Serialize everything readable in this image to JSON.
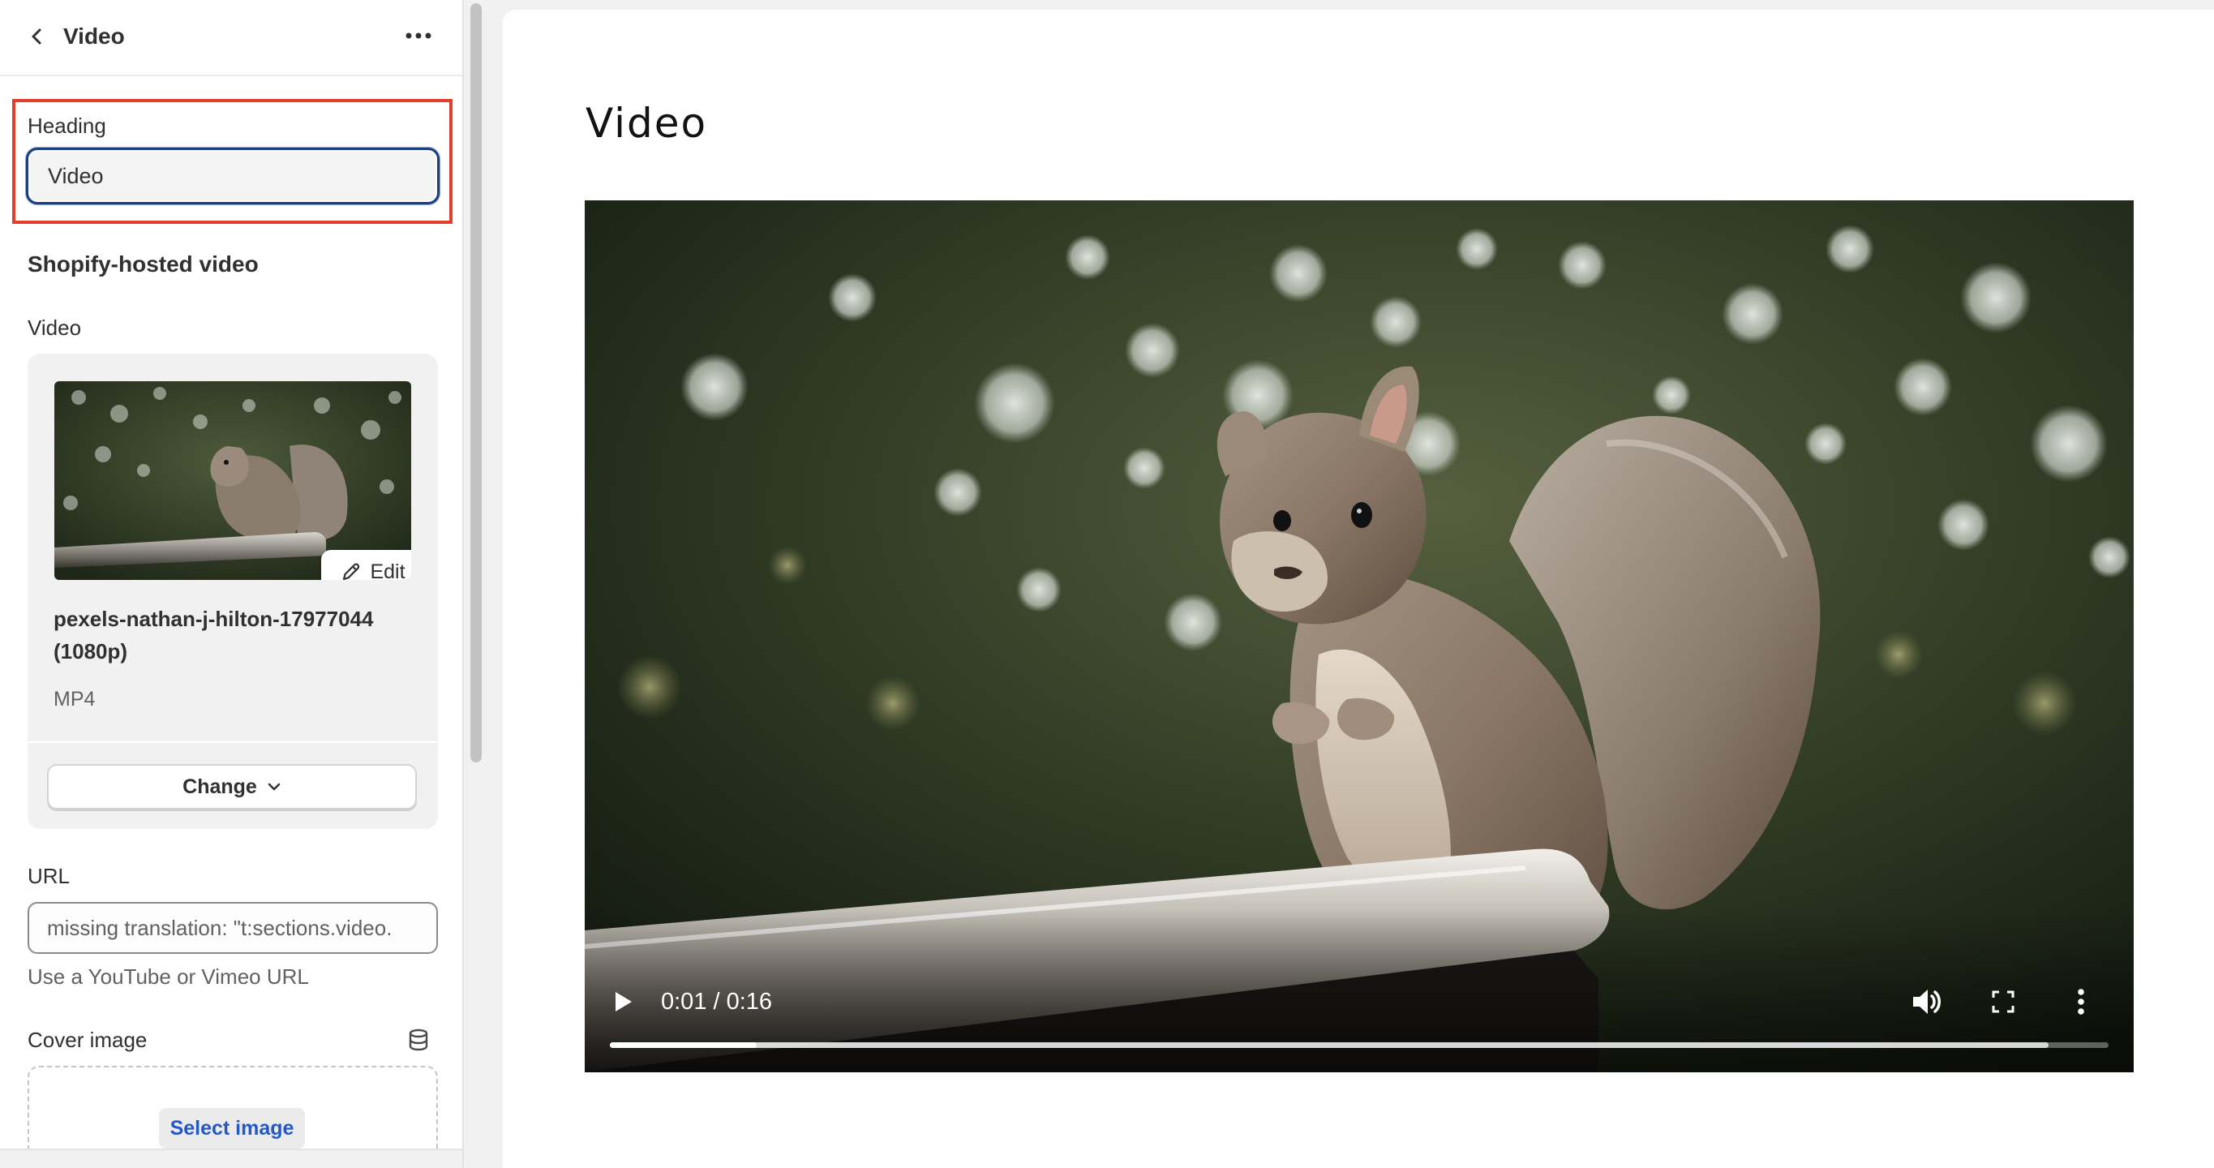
{
  "sidebar": {
    "title": "Video",
    "heading": {
      "label": "Heading",
      "value": "Video"
    },
    "hosted_video": {
      "title": "Shopify-hosted video",
      "label": "Video",
      "file_name": "pexels-nathan-j-hilton-17977044 (1080p)",
      "file_type": "MP4",
      "edit_label": "Edit",
      "change_label": "Change"
    },
    "url": {
      "label": "URL",
      "value": "missing translation: \"t:sections.video.",
      "help": "Use a YouTube or Vimeo URL"
    },
    "cover_image": {
      "label": "Cover image",
      "select_label": "Select image"
    }
  },
  "preview": {
    "title": "Video",
    "player": {
      "time": "0:01 / 0:16",
      "progress": 0.098,
      "buffered": 0.96
    }
  },
  "colors": {
    "highlight_border": "#e2402c",
    "focus_ring": "#1b3f80",
    "link_blue": "#2458c6"
  },
  "icons": [
    "back-icon",
    "more-horizontal-icon",
    "pencil-icon",
    "chevron-down-icon",
    "database-icon",
    "play-icon",
    "volume-icon",
    "fullscreen-icon",
    "more-vertical-icon"
  ]
}
